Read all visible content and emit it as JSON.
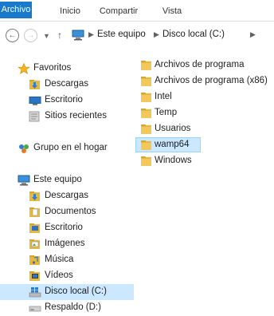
{
  "ribbon": {
    "tabs": [
      {
        "label": "Archivo",
        "active": true
      },
      {
        "label": "Inicio",
        "active": false
      },
      {
        "label": "Compartir",
        "active": false
      },
      {
        "label": "Vista",
        "active": false
      }
    ]
  },
  "address": {
    "crumbs": [
      "Este equipo",
      "Disco local (C:)"
    ]
  },
  "nav": {
    "favorites_label": "Favoritos",
    "favorites": [
      "Descargas",
      "Escritorio",
      "Sitios recientes"
    ],
    "homegroup_label": "Grupo en el hogar",
    "thispc_label": "Este equipo",
    "thispc_items": [
      "Descargas",
      "Documentos",
      "Escritorio",
      "Imágenes",
      "Música",
      "Vídeos",
      "Disco local (C:)",
      "Respaldo (D:)"
    ]
  },
  "content": {
    "folders": [
      "Archivos de programa",
      "Archivos de programa (x86)",
      "Intel",
      "Temp",
      "Usuarios",
      "wamp64",
      "Windows"
    ],
    "selected": "wamp64"
  },
  "colors": {
    "accent": "#1979ca",
    "selection": "#cce8ff",
    "folder": "#e8b83c"
  }
}
